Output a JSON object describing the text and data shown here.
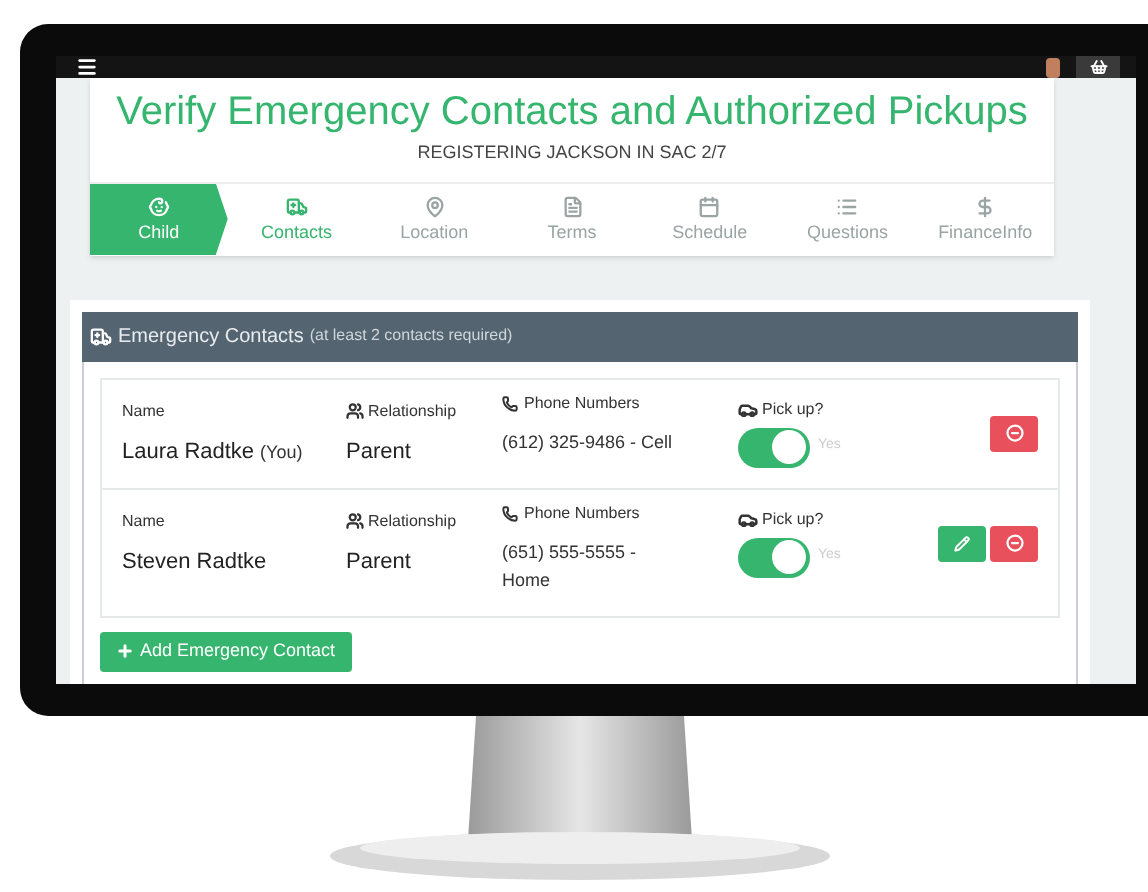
{
  "title": "Verify Emergency Contacts and Authorized Pickups",
  "subtitle": "REGISTERING JACKSON IN SAC 2/7",
  "steps": [
    {
      "label": "Child",
      "completed": true,
      "selected": false
    },
    {
      "label": "Contacts",
      "completed": false,
      "selected": true
    },
    {
      "label": "Location",
      "completed": false,
      "selected": false
    },
    {
      "label": "Terms",
      "completed": false,
      "selected": false
    },
    {
      "label": "Schedule",
      "completed": false,
      "selected": false
    },
    {
      "label": "Questions",
      "completed": false,
      "selected": false
    },
    {
      "label": "FinanceInfo",
      "completed": false,
      "selected": false
    }
  ],
  "panel": {
    "title": "Emergency Contacts",
    "note": "(at least 2 contacts required)"
  },
  "contacts": [
    {
      "name_label": "Name",
      "name": "Laura Radtke",
      "tag": "(You)",
      "relationship_label": "Relationship",
      "relationship": "Parent",
      "phone_label": "Phone Numbers",
      "phone": "(612) 325-9486 - Cell",
      "pickup_label": "Pick up?",
      "pickup": true,
      "pickup_text": "Yes",
      "editable": false,
      "removable": true
    },
    {
      "name_label": "Name",
      "name": "Steven Radtke",
      "relationship_label": "Relationship",
      "relationship": "Parent",
      "phone_label": "Phone Numbers",
      "phone": "(651) 555-5555 - Home",
      "pickup_label": "Pick up?",
      "pickup": true,
      "pickup_text": "Yes",
      "editable": true,
      "removable": true
    }
  ],
  "add_button": "Add Emergency Contact"
}
